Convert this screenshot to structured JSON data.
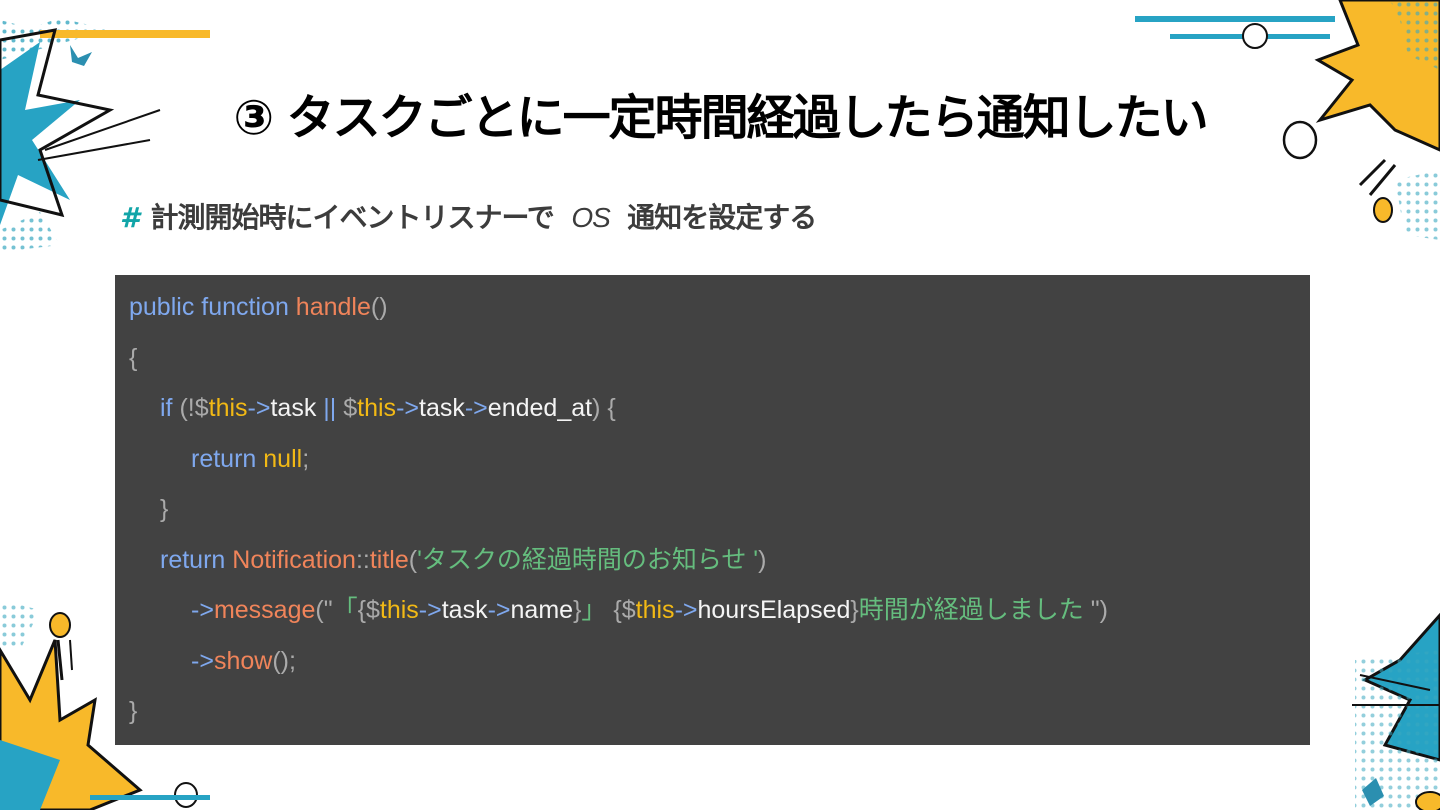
{
  "slide": {
    "title": "③ タスクごとに一定時間経過したら通知したい",
    "subtitle_hash": "#",
    "subtitle_before": "計測開始時にイベントリスナーで",
    "subtitle_os": "OS",
    "subtitle_after": "通知を設定する"
  },
  "code": {
    "l1_public": "public",
    "l1_function": "function",
    "l1_handle": "handle",
    "l1_parens": "()",
    "l2_brace": "{",
    "l3_if": "if",
    "l3_open": "(!$",
    "l3_this1": "this",
    "l3_arrow1": "->",
    "l3_task1": "task",
    "l3_or": "||",
    "l3_dollar": "$",
    "l3_this2": "this",
    "l3_arrow2": "->",
    "l3_task2": "task",
    "l3_arrow3": "->",
    "l3_ended": "ended_at",
    "l3_close": ") {",
    "l4_return": "return",
    "l4_null": "null",
    "l4_semi": ";",
    "l5_brace": "}",
    "l6_return": "return",
    "l6_notification": "Notification",
    "l6_colons": "::",
    "l6_title": "title",
    "l6_open": "(",
    "l6_string": "'タスクの経過時間のお知らせ '",
    "l6_close": ")",
    "l7_arrow": "->",
    "l7_message": "message",
    "l7_open": "(\"",
    "l7_bracket_open": "「",
    "l7_brace_dollar": "{$",
    "l7_this1": "this",
    "l7_arrow2": "->",
    "l7_task": "task",
    "l7_arrow3": "->",
    "l7_name": "name",
    "l7_brace_close": "}",
    "l7_bracket_close": "」",
    "l7_brace_dollar2": "{$",
    "l7_this2": "this",
    "l7_arrow4": "->",
    "l7_hours": "hoursElapsed",
    "l7_brace_close2": "}",
    "l7_tail": "時間が経過しました ",
    "l7_close": "\")",
    "l8_arrow": "->",
    "l8_show": "show",
    "l8_end": "();",
    "l9_brace": "}"
  },
  "colors": {
    "code_background": "#424242",
    "keyword": "#7fa8ee",
    "function": "#f0845a",
    "variable": "#f2b915",
    "string": "#65bd7e",
    "accent_teal": "#12a5a8",
    "accent_yellow": "#f8b92a"
  }
}
